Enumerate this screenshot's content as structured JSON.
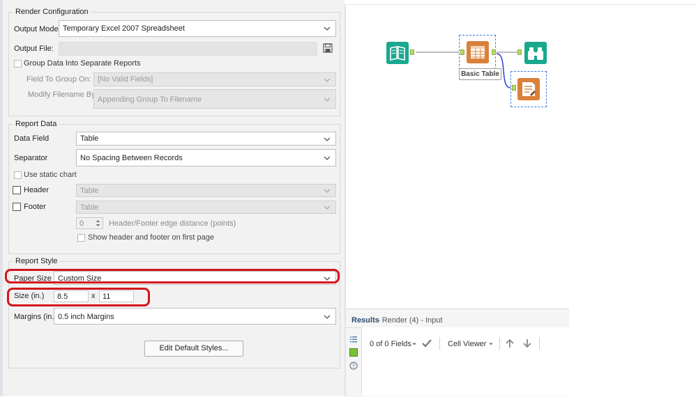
{
  "render_config": {
    "legend": "Render Configuration",
    "output_mode_label": "Output Mode:",
    "output_mode_value": "Temporary Excel 2007 Spreadsheet",
    "output_file_label": "Output File:",
    "output_file_value": "",
    "group_data_label": "Group Data Into Separate Reports",
    "field_to_group_label": "Field To Group On:",
    "field_to_group_value": "[No Valid Fields]",
    "modify_filename_label": "Modify Filename By:",
    "modify_filename_value": "Appending Group To Filename"
  },
  "report_data": {
    "legend": "Report Data",
    "data_field_label": "Data Field",
    "data_field_value": "Table",
    "separator_label": "Separator",
    "separator_value": "No Spacing Between Records",
    "static_chart_label": "Use static chart",
    "header_label": "Header",
    "header_value": "Table",
    "footer_label": "Footer",
    "footer_value": "Table",
    "edge_distance_value": "0",
    "edge_distance_label": "Header/Footer edge distance (points)",
    "show_header_footer_label": "Show header and footer on first page"
  },
  "report_style": {
    "legend": "Report Style",
    "paper_size_label": "Paper Size",
    "paper_size_value": "Custom Size",
    "size_label": "Size (in.)",
    "width_value": "8.5",
    "x_sep": "x",
    "height_value": "11",
    "margins_label": "Margins (in.)",
    "margins_value": "0.5 inch Margins",
    "edit_styles_button": "Edit Default Styles..."
  },
  "canvas": {
    "basic_table_label": "Basic Table"
  },
  "results": {
    "title": "Results",
    "subtitle": "- Render (4) - Input",
    "fields_text": "0 of 0 Fields",
    "cell_viewer_label": "Cell Viewer"
  },
  "colors": {
    "accent_teal": "#1aa88f",
    "accent_orange": "#d9813a",
    "highlight_red": "#d4141c"
  },
  "icons": [
    "chevron-down-icon",
    "save-icon",
    "book-icon",
    "table-icon",
    "binoculars-icon",
    "report-icon",
    "list-icon",
    "grid-icon",
    "help-icon",
    "checkmark-icon",
    "arrow-up-icon",
    "arrow-down-icon",
    "spinner-icon"
  ]
}
